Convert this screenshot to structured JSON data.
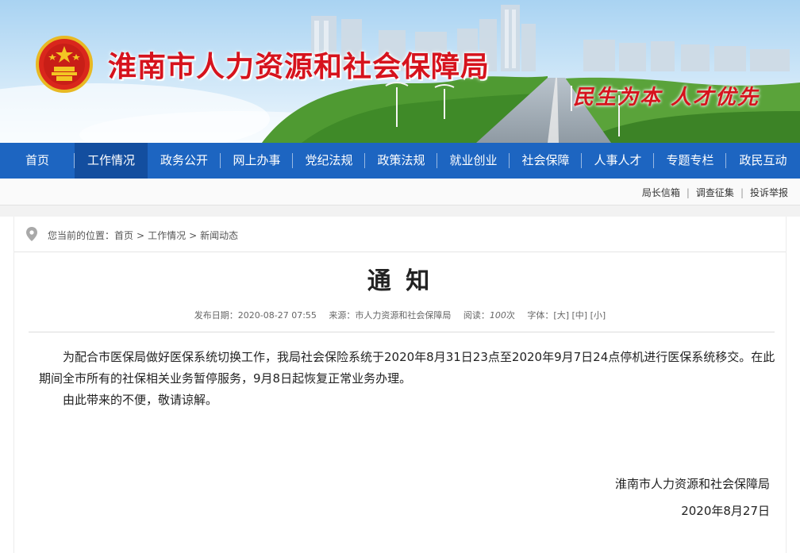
{
  "header": {
    "site_title": "淮南市人力资源和社会保障局",
    "slogan": "民生为本  人才优先"
  },
  "nav": {
    "items": [
      {
        "label": "首页"
      },
      {
        "label": "工作情况"
      },
      {
        "label": "政务公开"
      },
      {
        "label": "网上办事"
      },
      {
        "label": "党纪法规"
      },
      {
        "label": "政策法规"
      },
      {
        "label": "就业创业"
      },
      {
        "label": "社会保障"
      },
      {
        "label": "人事人才"
      },
      {
        "label": "专题专栏"
      },
      {
        "label": "政民互动"
      }
    ],
    "active_index": 1
  },
  "sublinks": [
    "局长信箱",
    "调查征集",
    "投诉举报"
  ],
  "breadcrumb": {
    "prefix": "您当前的位置：",
    "items": [
      "首页",
      "工作情况",
      "新闻动态"
    ],
    "separator": ">"
  },
  "article": {
    "title": "通 知",
    "meta": {
      "date_label": "发布日期：",
      "date": "2020-08-27 07:55",
      "source_label": "来源：",
      "source": "市人力资源和社会保障局",
      "views_label": "阅读：",
      "views": "100",
      "views_unit": "次",
      "font_label": "字体：",
      "font_sizes": [
        "[大]",
        "[中]",
        "[小]"
      ]
    },
    "paragraphs": [
      "为配合市医保局做好医保系统切换工作，我局社会保险系统于2020年8月31日23点至2020年9月7日24点停机进行医保系统移交。在此期间全市所有的社保相关业务暂停服务，9月8日起恢复正常业务办理。",
      "由此带来的不便，敬请谅解。"
    ],
    "signature": "淮南市人力资源和社会保障局",
    "sign_date": "2020年8月27日"
  },
  "colors": {
    "nav_bg": "#1d65c1",
    "nav_active": "#134e9f",
    "title_red": "#d6131d"
  }
}
